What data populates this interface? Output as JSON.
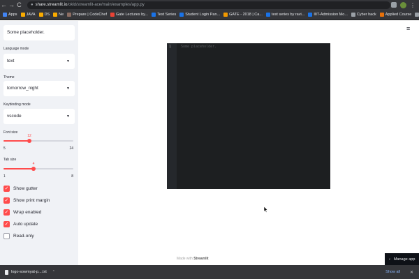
{
  "browser": {
    "nav": {
      "back": "←",
      "forward": "→",
      "reload": "C"
    },
    "url_host": "share.streamlit.io",
    "url_path": "/okld/streamlit-ace/main/examples/app.py",
    "bookmarks": [
      {
        "label": "Apps",
        "color": "#4285f4"
      },
      {
        "label": "JAVA",
        "color": "#f9ab00"
      },
      {
        "label": "DS",
        "color": "#f9ab00"
      },
      {
        "label": "Ne",
        "color": "#f9ab00"
      },
      {
        "label": "Prepare | CodeChef",
        "color": "#8d6e63"
      },
      {
        "label": "Gate Lectures by...",
        "color": "#ea4335"
      },
      {
        "label": "Test Series",
        "color": "#1a73e8"
      },
      {
        "label": "Student Login Pan...",
        "color": "#1a73e8"
      },
      {
        "label": "GATE - 2018 | Ca...",
        "color": "#f29900"
      },
      {
        "label": "test series by ravi...",
        "color": "#1a73e8"
      },
      {
        "label": "IIIT-Admission Mo...",
        "color": "#1a73e8"
      },
      {
        "label": "Cyber hack",
        "color": "#9aa0a6"
      },
      {
        "label": "Applied Course",
        "color": "#e8710a"
      },
      {
        "label": "gate test series",
        "color": "#9aa0a6"
      }
    ],
    "menu": "⋮"
  },
  "sidebar": {
    "textinput_value": "Some placeholder.",
    "language_label": "Language mode",
    "language_value": "text",
    "theme_label": "Theme",
    "theme_value": "tomorrow_night",
    "keybinding_label": "Keybinding mode",
    "keybinding_value": "vscode",
    "caret": "▼",
    "font_size": {
      "label": "Font size",
      "value": "12",
      "min": "5",
      "max": "24",
      "fraction": 0.37
    },
    "tab_size": {
      "label": "Tab size",
      "value": "4",
      "min": "1",
      "max": "8",
      "fraction": 0.43
    },
    "checkboxes": [
      {
        "label": "Show gutter",
        "checked": true
      },
      {
        "label": "Show print margin",
        "checked": true
      },
      {
        "label": "Wrap enabled",
        "checked": true
      },
      {
        "label": "Auto update",
        "checked": true
      },
      {
        "label": "Read-only",
        "checked": false
      }
    ],
    "check_glyph": "✓"
  },
  "main": {
    "hamburger": "≡",
    "editor": {
      "line_number": "1",
      "placeholder": "Some placeholder."
    },
    "footer_prefix": "Made with",
    "footer_brand": "Streamlit",
    "manage_app": "Manage app",
    "manage_glyph": "‹"
  },
  "downloads": {
    "item": "logo-sowmyat-p....txt",
    "caret": "⌃",
    "show_all": "Show all",
    "close": "✕"
  }
}
